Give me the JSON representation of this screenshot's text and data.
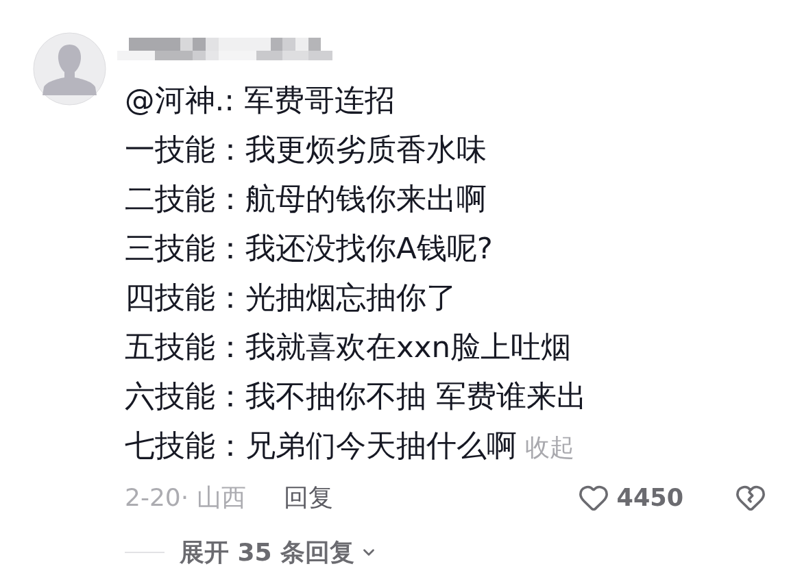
{
  "comment": {
    "lines": [
      "@河神.: 军费哥连招",
      "一技能：我更烦劣质香水味",
      "二技能：航母的钱你来出啊",
      "三技能：我还没找你A钱呢?",
      "四技能：光抽烟忘抽你了",
      "五技能：我就喜欢在xxn脸上吐烟",
      "六技能：我不抽你不抽 军费谁来出",
      "七技能：兄弟们今天抽什么啊"
    ],
    "collapse_link": "收起",
    "date_location": "2-20· 山西",
    "reply_button": "回复",
    "like_count": "4450",
    "liked": false,
    "disliked": false
  },
  "expand_replies": {
    "label": "展开 35 条回复"
  }
}
